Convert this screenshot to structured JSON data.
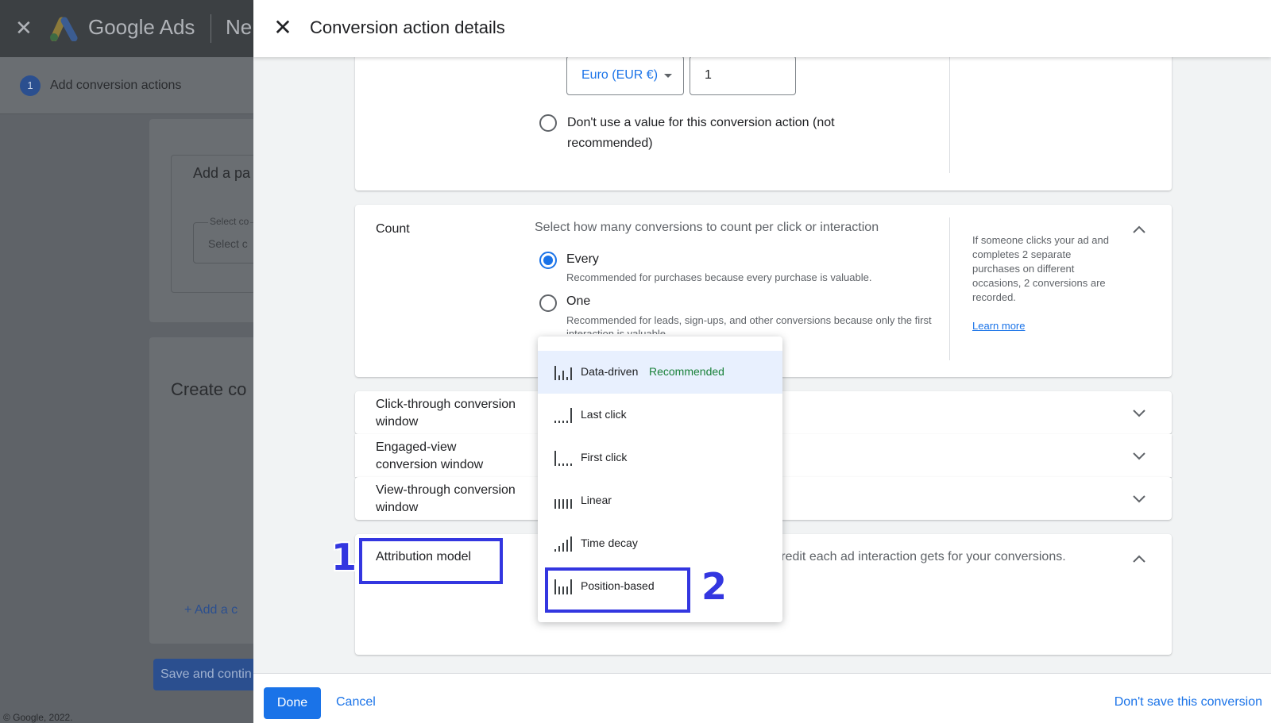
{
  "background": {
    "brand": "Google Ads",
    "next_partial": "Ne",
    "step_number": "1",
    "step_label": "Add conversion actions",
    "add_partial": "Add a pa",
    "select_label_partial": "Select co",
    "select_value_partial": "Select c",
    "create_partial": "Create co",
    "add_link_partial": "+ Add a c",
    "save_partial": "Save and contin",
    "copyright": "© Google, 2022."
  },
  "dialog": {
    "title": "Conversion action details",
    "value": {
      "currency": "Euro (EUR €)",
      "amount": "1",
      "no_value_option": "Don't use a value for this conversion action (not recommended)"
    },
    "count": {
      "title": "Count",
      "description": "Select how many conversions to count per click or interaction",
      "options": [
        {
          "label": "Every",
          "desc": "Recommended for purchases because every purchase is valuable.",
          "selected": true
        },
        {
          "label": "One",
          "desc": "Recommended for leads, sign-ups, and other conversions because only the first interaction is valuable.",
          "selected": false
        }
      ],
      "help": "If someone clicks your ad and completes 2 separate purchases on different occasions, 2 conversions are recorded.",
      "learn_more": "Learn more"
    },
    "rows": {
      "click_through": "Click-through conversion window",
      "engaged_view": "Engaged-view conversion window",
      "view_through": "View-through conversion window"
    },
    "attribution": {
      "title": "Attribution model",
      "description_partial": "uch credit each ad interaction gets for your conversions."
    },
    "menu": [
      {
        "label": "Data-driven",
        "badge": "Recommended",
        "icon": "data-driven-icon",
        "selected": true
      },
      {
        "label": "Last click",
        "icon": "last-click-icon"
      },
      {
        "label": "First click",
        "icon": "first-click-icon"
      },
      {
        "label": "Linear",
        "icon": "linear-icon"
      },
      {
        "label": "Time decay",
        "icon": "time-decay-icon"
      },
      {
        "label": "Position-based",
        "icon": "position-based-icon"
      }
    ],
    "footer": {
      "done": "Done",
      "cancel": "Cancel",
      "dont_save": "Don't save this conversion"
    }
  },
  "annotations": {
    "one": "1",
    "two": "2"
  },
  "colors": {
    "accent": "#1a73e8",
    "annotation": "#3336e0",
    "recommended": "#188038"
  }
}
